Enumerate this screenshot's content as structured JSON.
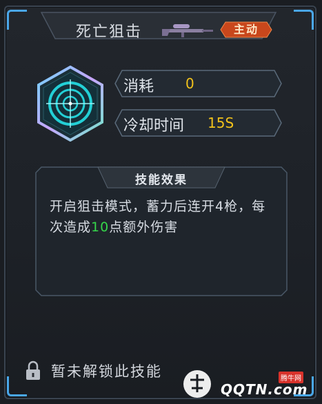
{
  "skill": {
    "name": "死亡狙击",
    "type_badge": "主动",
    "weapon_icon": "sniper-rifle-icon",
    "emblem_icon": "crosshair-icon"
  },
  "stats": [
    {
      "label": "消耗",
      "value": "0"
    },
    {
      "label": "冷却时间",
      "value": "15S"
    }
  ],
  "effect": {
    "title": "技能效果",
    "text_before": "开启狙击模式，蓄力后连开4枪，每次造成",
    "highlight": "10",
    "text_after": "点额外伤害"
  },
  "lock": {
    "icon": "lock-icon",
    "text": "暂未解锁此技能"
  },
  "watermark": {
    "brand": "QQTN.com",
    "tag": "腾牛网"
  },
  "colors": {
    "accent_blue": "#4fb6ff",
    "value_yellow": "#f2c21b",
    "highlight_green": "#35d64a",
    "badge_orange": "#c9471c"
  }
}
